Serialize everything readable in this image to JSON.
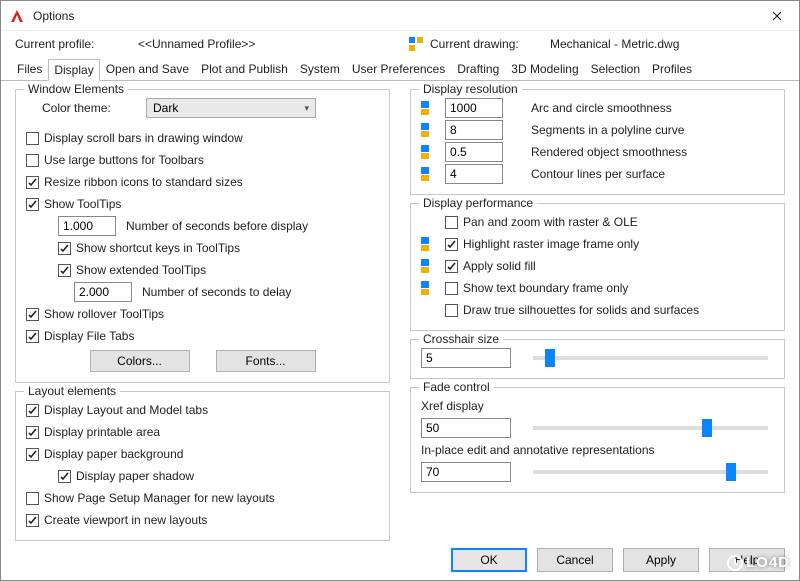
{
  "window": {
    "title": "Options"
  },
  "profile": {
    "current_profile_label": "Current profile:",
    "current_profile_value": "<<Unnamed Profile>>",
    "current_drawing_label": "Current drawing:",
    "current_drawing_value": "Mechanical - Metric.dwg"
  },
  "tabs": {
    "files": "Files",
    "display": "Display",
    "open_and_save": "Open and Save",
    "plot_and_publish": "Plot and Publish",
    "system": "System",
    "user_prefs": "User Preferences",
    "drafting": "Drafting",
    "modeling3d": "3D Modeling",
    "selection": "Selection",
    "profiles": "Profiles"
  },
  "window_elements": {
    "title": "Window Elements",
    "color_theme_label": "Color theme:",
    "color_theme_value": "Dark",
    "display_scroll_bars": "Display scroll bars in drawing window",
    "use_large_buttons": "Use large buttons for Toolbars",
    "resize_ribbon": "Resize ribbon icons to standard sizes",
    "show_tooltips": "Show ToolTips",
    "secs_before_display_value": "1.000",
    "secs_before_display_label": "Number of seconds before display",
    "show_shortcut_keys": "Show shortcut keys in ToolTips",
    "show_extended_tooltips": "Show extended ToolTips",
    "secs_to_delay_value": "2.000",
    "secs_to_delay_label": "Number of seconds to delay",
    "show_rollover": "Show rollover ToolTips",
    "display_file_tabs": "Display File Tabs",
    "btn_colors": "Colors...",
    "btn_fonts": "Fonts..."
  },
  "layout_elements": {
    "title": "Layout elements",
    "display_layout_model_tabs": "Display Layout and Model tabs",
    "display_printable": "Display printable area",
    "display_paper_bg": "Display paper background",
    "display_paper_shadow": "Display paper shadow",
    "show_page_setup": "Show Page Setup Manager for new layouts",
    "create_viewport": "Create viewport in new layouts"
  },
  "display_resolution": {
    "title": "Display resolution",
    "arc_value": "1000",
    "arc_label": "Arc and circle smoothness",
    "seg_value": "8",
    "seg_label": "Segments in a polyline curve",
    "rendered_value": "0.5",
    "rendered_label": "Rendered object smoothness",
    "contour_value": "4",
    "contour_label": "Contour lines per surface"
  },
  "display_perf": {
    "title": "Display performance",
    "pan_zoom": "Pan and zoom with raster & OLE",
    "highlight_raster": "Highlight raster image frame only",
    "apply_solid": "Apply solid fill",
    "show_text_boundary": "Show text boundary frame only",
    "draw_silhouettes": "Draw true silhouettes for solids and surfaces"
  },
  "crosshair": {
    "title": "Crosshair size",
    "value": "5"
  },
  "fade": {
    "title": "Fade control",
    "xref_label": "Xref display",
    "xref_value": "50",
    "inplace_label": "In-place edit and annotative representations",
    "inplace_value": "70"
  },
  "footer": {
    "ok": "OK",
    "cancel": "Cancel",
    "apply": "Apply",
    "help": "Help"
  },
  "watermark": "LO4D"
}
